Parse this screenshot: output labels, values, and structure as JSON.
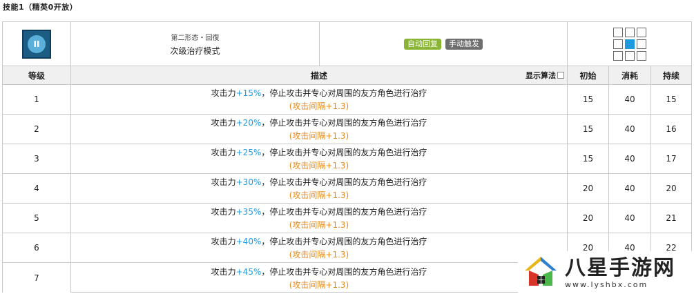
{
  "section_title": "技能1（精英0开放）",
  "skill": {
    "icon_name": "skill-icon",
    "sub_label": "第二形态・回復",
    "name": "次级治疗模式",
    "tags": [
      "自动回复",
      "手动触发"
    ],
    "range_cells": [
      false,
      false,
      false,
      false,
      true,
      false,
      false,
      false,
      false
    ]
  },
  "headers": {
    "level": "等级",
    "description": "描述",
    "show_algorithm": "显示算法",
    "initial": "初始",
    "cost": "消耗",
    "duration": "持续"
  },
  "rows": [
    {
      "level": "1",
      "pre": "攻击力",
      "value": "+15%",
      "post": "，停止攻击并专心对周围的友方角色进行治疗",
      "note": "(攻击间隔+1.3)",
      "initial": "15",
      "cost": "40",
      "duration": "15"
    },
    {
      "level": "2",
      "pre": "攻击力",
      "value": "+20%",
      "post": "，停止攻击并专心对周围的友方角色进行治疗",
      "note": "(攻击间隔+1.3)",
      "initial": "15",
      "cost": "40",
      "duration": "16"
    },
    {
      "level": "3",
      "pre": "攻击力",
      "value": "+25%",
      "post": "，停止攻击并专心对周围的友方角色进行治疗",
      "note": "(攻击间隔+1.3)",
      "initial": "15",
      "cost": "40",
      "duration": "17"
    },
    {
      "level": "4",
      "pre": "攻击力",
      "value": "+30%",
      "post": "，停止攻击并专心对周围的友方角色进行治疗",
      "note": "(攻击间隔+1.3)",
      "initial": "20",
      "cost": "40",
      "duration": "20"
    },
    {
      "level": "5",
      "pre": "攻击力",
      "value": "+35%",
      "post": "，停止攻击并专心对周围的友方角色进行治疗",
      "note": "(攻击间隔+1.3)",
      "initial": "20",
      "cost": "40",
      "duration": "21"
    },
    {
      "level": "6",
      "pre": "攻击力",
      "value": "+40%",
      "post": "，停止攻击并专心对周围的友方角色进行治疗",
      "note": "(攻击间隔+1.3)",
      "initial": "20",
      "cost": "40",
      "duration": "22"
    },
    {
      "level": "7",
      "pre": "攻击力",
      "value": "+45%",
      "post": "，停止攻击并专心对周围的友方角色进行治疗",
      "note": "(攻击间隔+1.3)",
      "initial": "",
      "cost": "",
      "duration": ""
    }
  ],
  "watermark": {
    "title": "八星手游网",
    "url": "www.lyshbx.com"
  },
  "colors": {
    "highlight": "#1e9ae0",
    "note": "#e88a1a",
    "tag_auto": "#8ab534",
    "tag_manual": "#6e6e6e"
  }
}
